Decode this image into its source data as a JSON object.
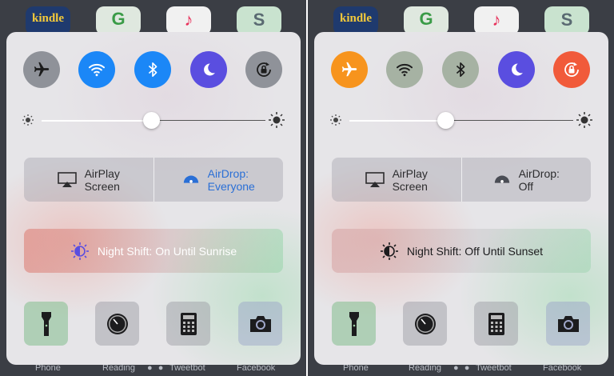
{
  "home_screen": {
    "apps": [
      "kindle",
      "G",
      "♪",
      "S"
    ],
    "dock": [
      "Phone",
      "Reading",
      "Tweetbot",
      "Facebook"
    ],
    "page_dots": "● ●"
  },
  "panels": [
    {
      "state": "before",
      "toggles": [
        {
          "name": "airplane-mode",
          "on": false
        },
        {
          "name": "wifi",
          "on": true
        },
        {
          "name": "bluetooth",
          "on": true
        },
        {
          "name": "do-not-disturb",
          "on": true
        },
        {
          "name": "rotation-lock",
          "on": false
        }
      ],
      "brightness": 0.49,
      "airplay": {
        "line1": "AirPlay",
        "line2": "Screen"
      },
      "airdrop": {
        "line1": "AirDrop:",
        "line2": "Everyone"
      },
      "night_shift": "Night Shift: On Until Sunrise"
    },
    {
      "state": "after",
      "toggles": [
        {
          "name": "airplane-mode",
          "on": true
        },
        {
          "name": "wifi",
          "on": false
        },
        {
          "name": "bluetooth",
          "on": false
        },
        {
          "name": "do-not-disturb",
          "on": true
        },
        {
          "name": "rotation-lock",
          "on": true
        }
      ],
      "brightness": 0.43,
      "airplay": {
        "line1": "AirPlay",
        "line2": "Screen"
      },
      "airdrop": {
        "line1": "AirDrop:",
        "line2": "Off"
      },
      "night_shift": "Night Shift: Off Until Sunset"
    }
  ],
  "colors": {
    "accent_blue": "#1b87f7",
    "dnd_purple": "#5a4ee0",
    "airplane_orange": "#f7941d",
    "rotation_red": "#f15a3a"
  }
}
